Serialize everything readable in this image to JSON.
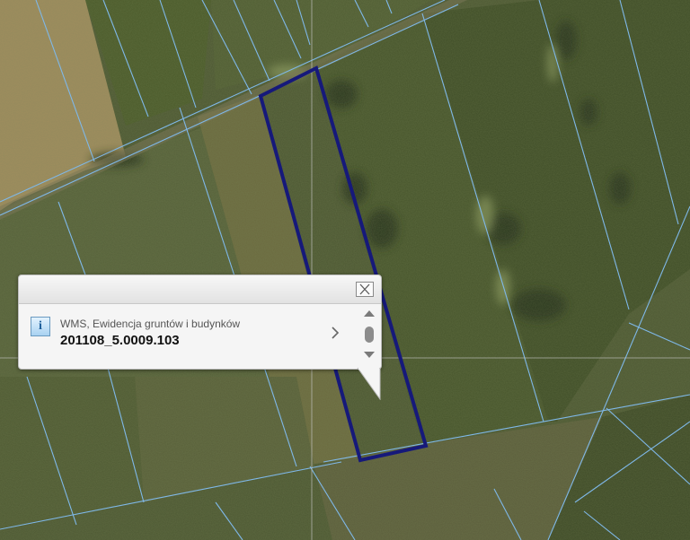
{
  "map": {
    "description_colors": {
      "parcel_line": "#7fb8e8",
      "selected_parcel": "#16197a",
      "crosshair": "#c8c8c8"
    }
  },
  "popup": {
    "layer_name": "WMS, Ewidencja gruntów i budynków",
    "parcel_id": "201108_5.0009.103",
    "info_icon_glyph": "i",
    "icons": [
      "info-icon",
      "close-icon",
      "chevron-right-icon",
      "arrow-up-icon",
      "arrow-down-icon"
    ]
  }
}
